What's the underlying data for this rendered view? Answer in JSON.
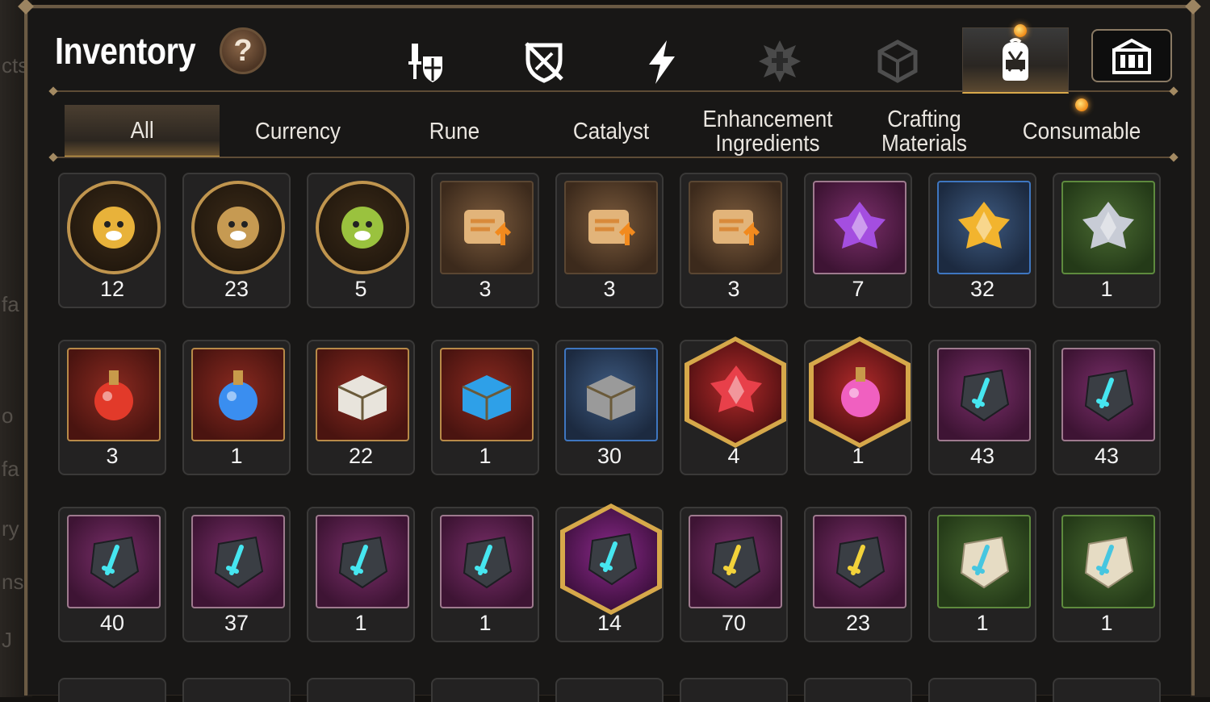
{
  "title": "Inventory",
  "help_label": "?",
  "top_tabs": [
    {
      "name": "tab-equipment",
      "icon": "knight-shield-icon",
      "active": false
    },
    {
      "name": "tab-artifact",
      "icon": "broken-shield-icon",
      "active": false
    },
    {
      "name": "tab-lightning",
      "icon": "lightning-icon",
      "active": false
    },
    {
      "name": "tab-spirit",
      "icon": "dark-emblem-icon",
      "active": false
    },
    {
      "name": "tab-cube",
      "icon": "cube-icon",
      "active": false
    },
    {
      "name": "tab-bag",
      "icon": "backpack-icon",
      "active": true
    },
    {
      "name": "tab-guild",
      "icon": "castle-icon",
      "active": false
    }
  ],
  "sub_tabs": {
    "all": "All",
    "currency": "Currency",
    "rune": "Rune",
    "catalyst": "Catalyst",
    "enhancement": "Enhancement\nIngredients",
    "crafting": "Crafting\nMaterials",
    "consumable": "Consumable"
  },
  "active_sub_tab": "All",
  "items": [
    {
      "name": "golden-phoenix-token",
      "frame": "circle",
      "color": "#e8b23a",
      "count": "12"
    },
    {
      "name": "deer-spirit-token",
      "frame": "circle",
      "color": "#c69a52",
      "count": "23"
    },
    {
      "name": "leaf-spirit-token",
      "frame": "circle",
      "color": "#9ac23e",
      "count": "5"
    },
    {
      "name": "upgrade-scroll",
      "frame": "brown",
      "color": "#d98a3a",
      "count": "3"
    },
    {
      "name": "rainbow-upgrade-scroll",
      "frame": "brown",
      "color": "#d98a3a",
      "count": "3"
    },
    {
      "name": "bag-upgrade-scroll",
      "frame": "brown",
      "color": "#d98a3a",
      "count": "3"
    },
    {
      "name": "purple-crystal",
      "frame": "purple",
      "color": "#a44ee0",
      "count": "7"
    },
    {
      "name": "gold-crystal",
      "frame": "blue",
      "color": "#f2b42e",
      "count": "32"
    },
    {
      "name": "silver-crystal",
      "frame": "green",
      "color": "#c8ccd6",
      "count": "1"
    },
    {
      "name": "red-potion",
      "frame": "red",
      "color": "#e23a2a",
      "count": "3"
    },
    {
      "name": "star-potion",
      "frame": "red",
      "color": "#3a8ef0",
      "count": "1"
    },
    {
      "name": "white-chest",
      "frame": "red",
      "color": "#e8e4dc",
      "count": "22"
    },
    {
      "name": "blue-chest",
      "frame": "red",
      "color": "#2ea0e8",
      "count": "1"
    },
    {
      "name": "grey-chest",
      "frame": "blue",
      "color": "#9a9a9a",
      "count": "30"
    },
    {
      "name": "red-rune-stone",
      "frame": "hex-red",
      "color": "#e8404a",
      "count": "4"
    },
    {
      "name": "pink-potion",
      "frame": "hex-red",
      "color": "#f060c0",
      "count": "1"
    },
    {
      "name": "sword-rune",
      "frame": "purple",
      "color": "#46e6f0",
      "count": "43"
    },
    {
      "name": "hook-rune",
      "frame": "purple",
      "color": "#46e6f0",
      "count": "43"
    },
    {
      "name": "armor-rune",
      "frame": "purple",
      "color": "#46e6f0",
      "count": "40"
    },
    {
      "name": "boot-rune",
      "frame": "purple",
      "color": "#46e6f0",
      "count": "37"
    },
    {
      "name": "ring-rune",
      "frame": "purple",
      "color": "#46e6f0",
      "count": "1"
    },
    {
      "name": "necklace-rune",
      "frame": "purple",
      "color": "#46e6f0",
      "count": "1"
    },
    {
      "name": "star-rune",
      "frame": "hex-purple",
      "color": "#46e6f0",
      "count": "14"
    },
    {
      "name": "hammer-rune",
      "frame": "purple",
      "color": "#f2d23a",
      "count": "70"
    },
    {
      "name": "bolt-rune",
      "frame": "purple",
      "color": "#f2d23a",
      "count": "23"
    },
    {
      "name": "stone-sword-rune",
      "frame": "green",
      "color": "#46c6e0",
      "count": "1"
    },
    {
      "name": "stone-hook-rune",
      "frame": "green",
      "color": "#46c6e0",
      "count": "1"
    }
  ]
}
